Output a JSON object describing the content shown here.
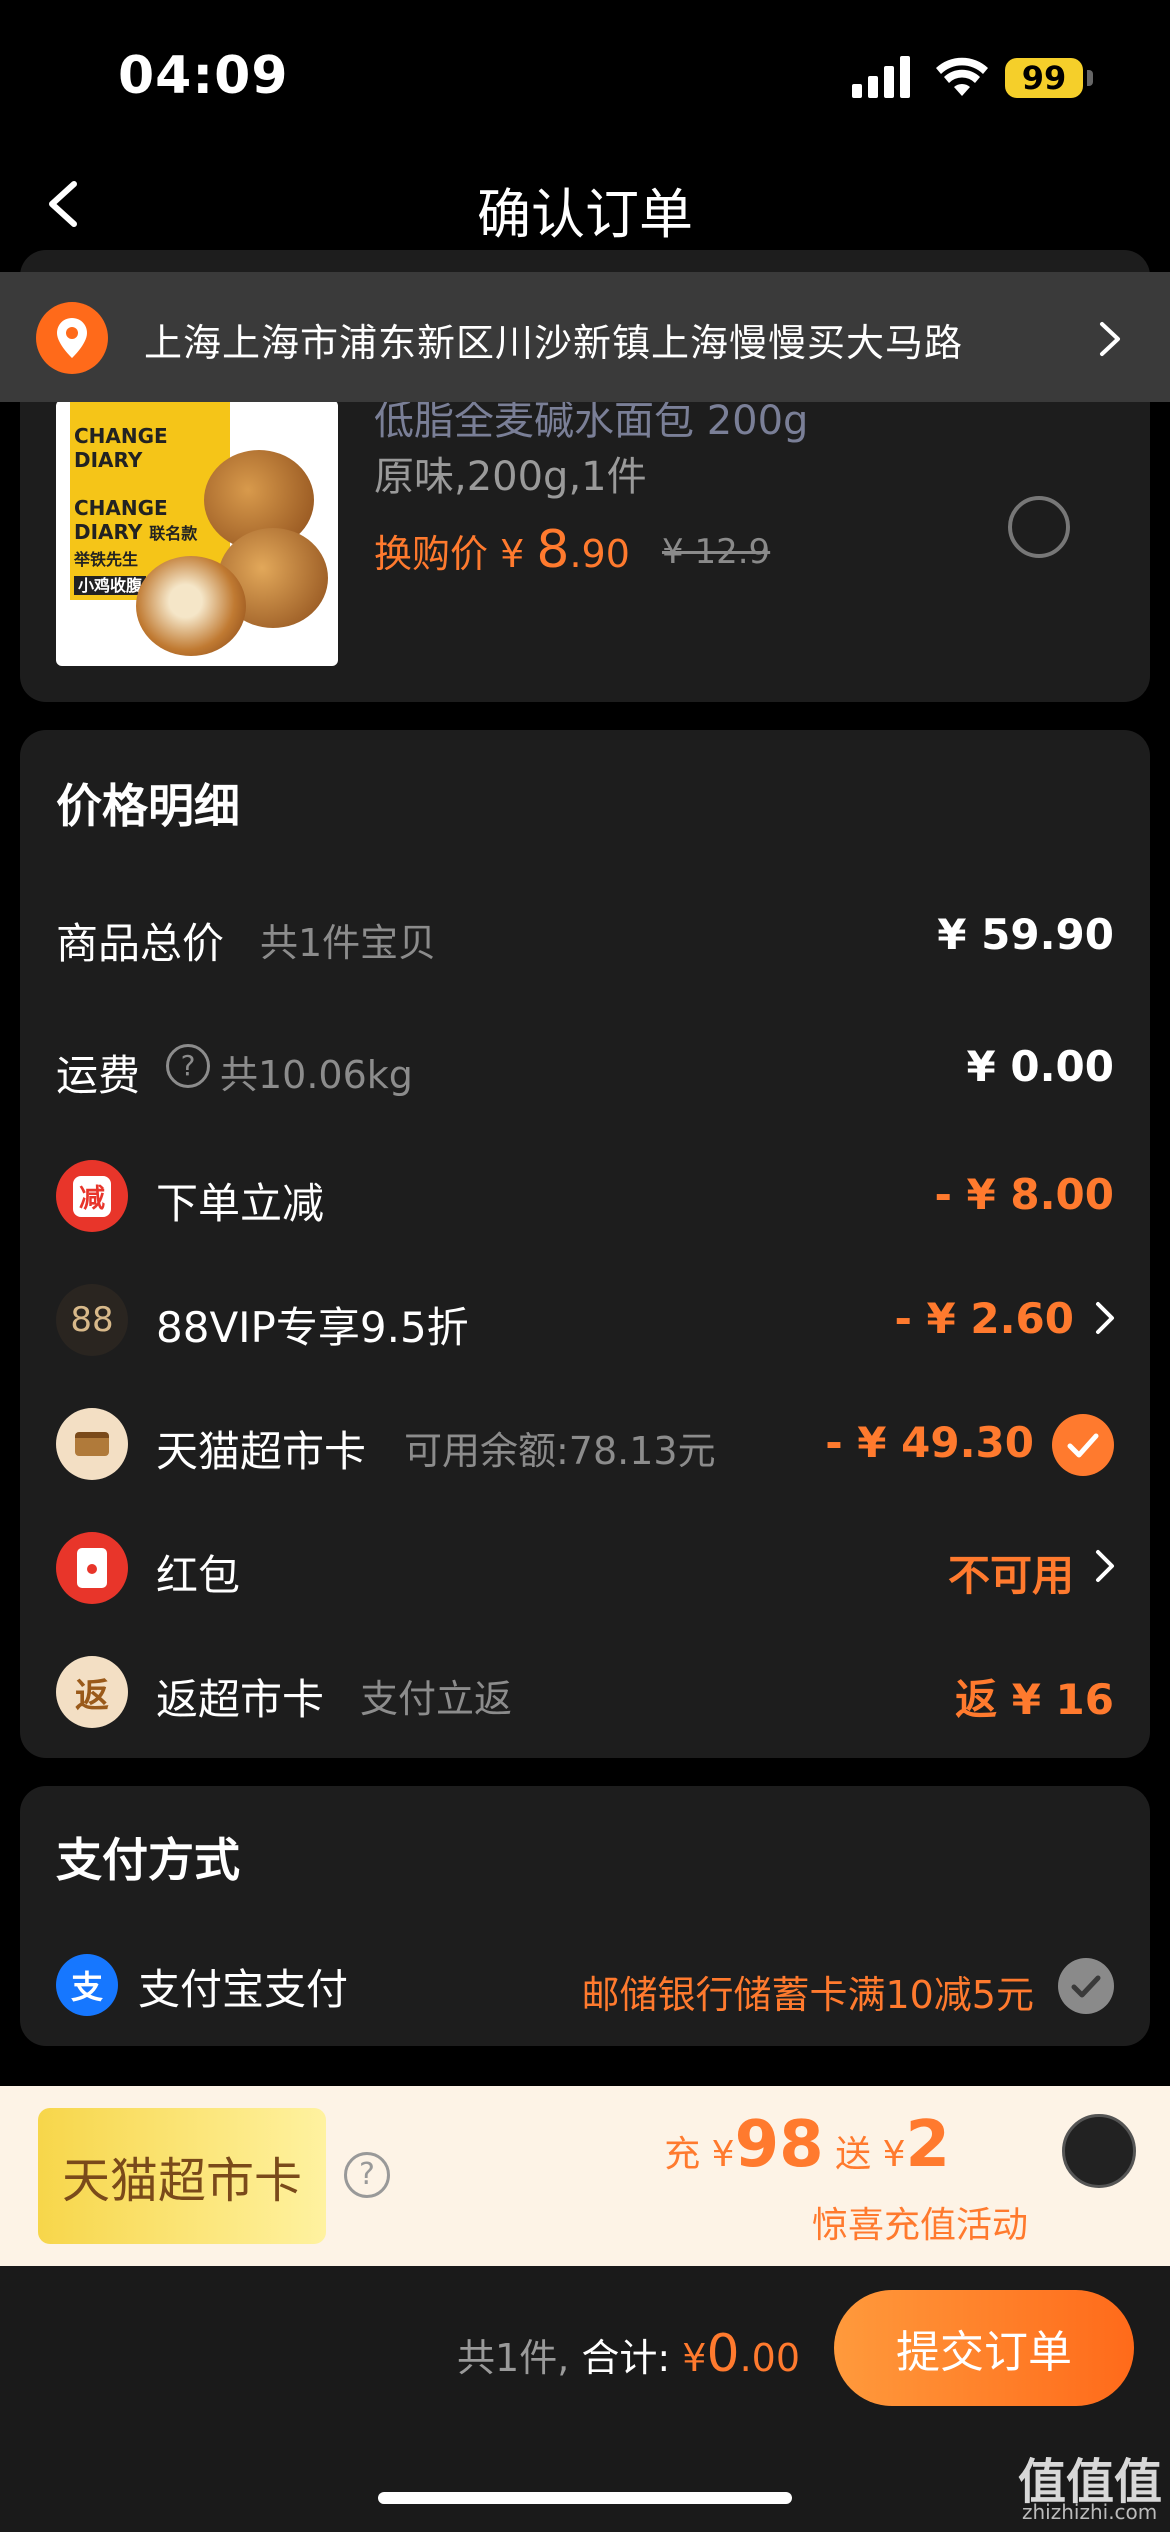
{
  "status_bar": {
    "time": "04:09",
    "battery": "99"
  },
  "nav": {
    "title": "确认订单"
  },
  "address": {
    "text": "上海上海市浦东新区川沙新镇上海慢慢买大马路"
  },
  "product": {
    "name": "低脂全麦碱水面包 200g",
    "spec": "原味,200g,1件",
    "price_label": "换购价 ¥ ",
    "price_int": "8",
    "price_dec": ".90",
    "orig_price": "¥ 12.9",
    "img_texts": [
      "CHANGE",
      "DIARY",
      "CHANGE",
      "DIARY",
      "联名款",
      "举铁先生",
      "小鸡收腹"
    ]
  },
  "price_detail": {
    "title": "价格明细",
    "rows": [
      {
        "label": "商品总价",
        "sub": "共1件宝贝",
        "value": "¥ 59.90"
      },
      {
        "label": "运费",
        "sub": "共10.06kg",
        "value": "¥ 0.00"
      },
      {
        "icon": "减",
        "label": "下单立减",
        "value": "- ¥ 8.00"
      },
      {
        "icon": "88",
        "label": "88VIP专享9.5折",
        "value": "- ¥ 2.60"
      },
      {
        "label": "天猫超市卡",
        "sub": "可用余额:78.13元",
        "value": "- ¥ 49.30"
      },
      {
        "label": "红包",
        "value": "不可用"
      },
      {
        "icon": "返",
        "label": "返超市卡",
        "sub": "支付立返",
        "value": "返 ¥ 16"
      }
    ]
  },
  "payment": {
    "title": "支付方式",
    "icon": "支",
    "method": "支付宝支付",
    "offer": "邮储银行储蓄卡满10减5元"
  },
  "promo": {
    "card_text": "天猫超市卡",
    "charge_label": "充",
    "charge_currency": "¥",
    "charge_amount": "98",
    "bonus_label": "送",
    "bonus_currency": "¥",
    "bonus_amount": "2",
    "subtitle": "惊喜充值活动"
  },
  "footer": {
    "count": "共1件,",
    "total_label": "合计:",
    "currency": "¥",
    "total_int": "0",
    "total_dec": ".00",
    "submit": "提交订单"
  },
  "watermark": {
    "main": "值值值",
    "sub": "zhizhizhi.com"
  }
}
